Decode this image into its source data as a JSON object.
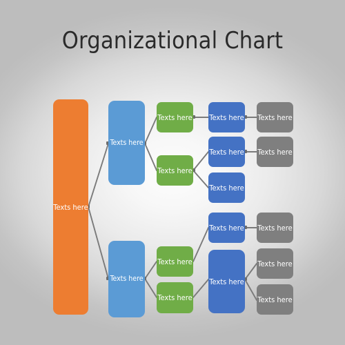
{
  "slide": {
    "title": "Organizational Chart",
    "background_edge_color": "#bfbfbf",
    "background_center_color": "#fdfdfd"
  },
  "palette": {
    "root": "#ED7D31",
    "level1": "#5B9BD5",
    "level2": "#70AD47",
    "level3": "#4472C4",
    "level4": "#7F7F7F",
    "connector": "#7f7f7f",
    "label_color": "#ffffff"
  },
  "chart_data": {
    "type": "diagram",
    "diagram_type": "organizational-chart",
    "title": "Organizational Chart",
    "default_label": "Texts here",
    "node_count": 16,
    "columns": [
      {
        "index": 0,
        "color": "#ED7D31",
        "count": 1
      },
      {
        "index": 1,
        "color": "#5B9BD5",
        "count": 2
      },
      {
        "index": 2,
        "color": "#70AD47",
        "count": 4
      },
      {
        "index": 3,
        "color": "#4472C4",
        "count": 5
      },
      {
        "index": 4,
        "color": "#7F7F7F",
        "count": 4
      }
    ]
  },
  "nodes": {
    "root": {
      "label": "Texts here"
    },
    "l1_top": {
      "label": "Texts here"
    },
    "l1_bottom": {
      "label": "Texts here"
    },
    "g_top1": {
      "label": "Texts here"
    },
    "g_top2": {
      "label": "Texts here"
    },
    "g_bot1": {
      "label": "Texts here"
    },
    "g_bot2": {
      "label": "Texts here"
    },
    "b_1": {
      "label": "Texts here"
    },
    "b_2": {
      "label": "Texts here"
    },
    "b_3": {
      "label": "Texts here"
    },
    "b_4": {
      "label": "Texts here"
    },
    "b_5": {
      "label": "Texts here"
    },
    "gr_1": {
      "label": "Texts here"
    },
    "gr_2": {
      "label": "Texts here"
    },
    "gr_3": {
      "label": "Texts here"
    },
    "gr_4": {
      "label": "Texts here"
    }
  }
}
